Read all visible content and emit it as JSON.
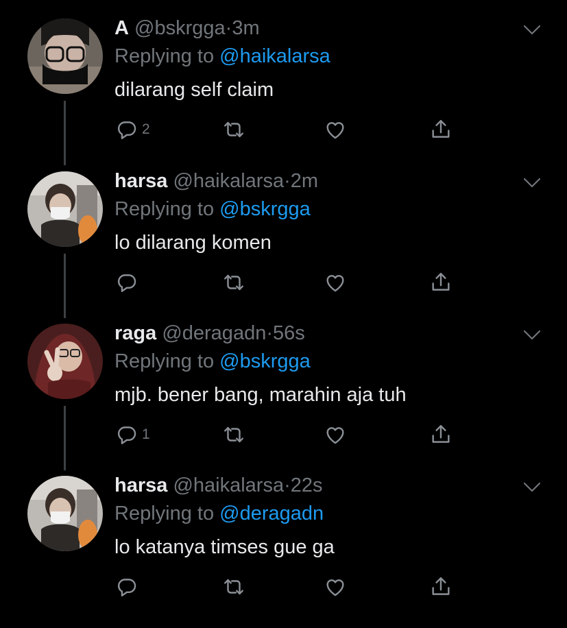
{
  "reply_prefix": "Replying to",
  "colors": {
    "background": "#000000",
    "text": "#e7e9ea",
    "muted": "#71767b",
    "link": "#1d9bf0"
  },
  "tweets": [
    {
      "name": "A",
      "handle": "@bskrgga",
      "time": "3m",
      "replying_to": "@haikalarsa",
      "text": "dilarang self claim",
      "reply_count": "2",
      "avatar": "avatar-glasses-person"
    },
    {
      "name": "harsa",
      "handle": "@haikalarsa",
      "time": "2m",
      "replying_to": "@bskrgga",
      "text": "lo dilarang komen",
      "reply_count": "",
      "avatar": "avatar-masked-person"
    },
    {
      "name": "raga",
      "handle": "@deragadn",
      "time": "56s",
      "replying_to": "@bskrgga",
      "text": "mjb. bener bang, marahin aja tuh",
      "reply_count": "1",
      "avatar": "avatar-peace-sign-person"
    },
    {
      "name": "harsa",
      "handle": "@haikalarsa",
      "time": "22s",
      "replying_to": "@deragadn",
      "text": "lo katanya timses gue ga",
      "reply_count": "",
      "avatar": "avatar-masked-person"
    }
  ]
}
